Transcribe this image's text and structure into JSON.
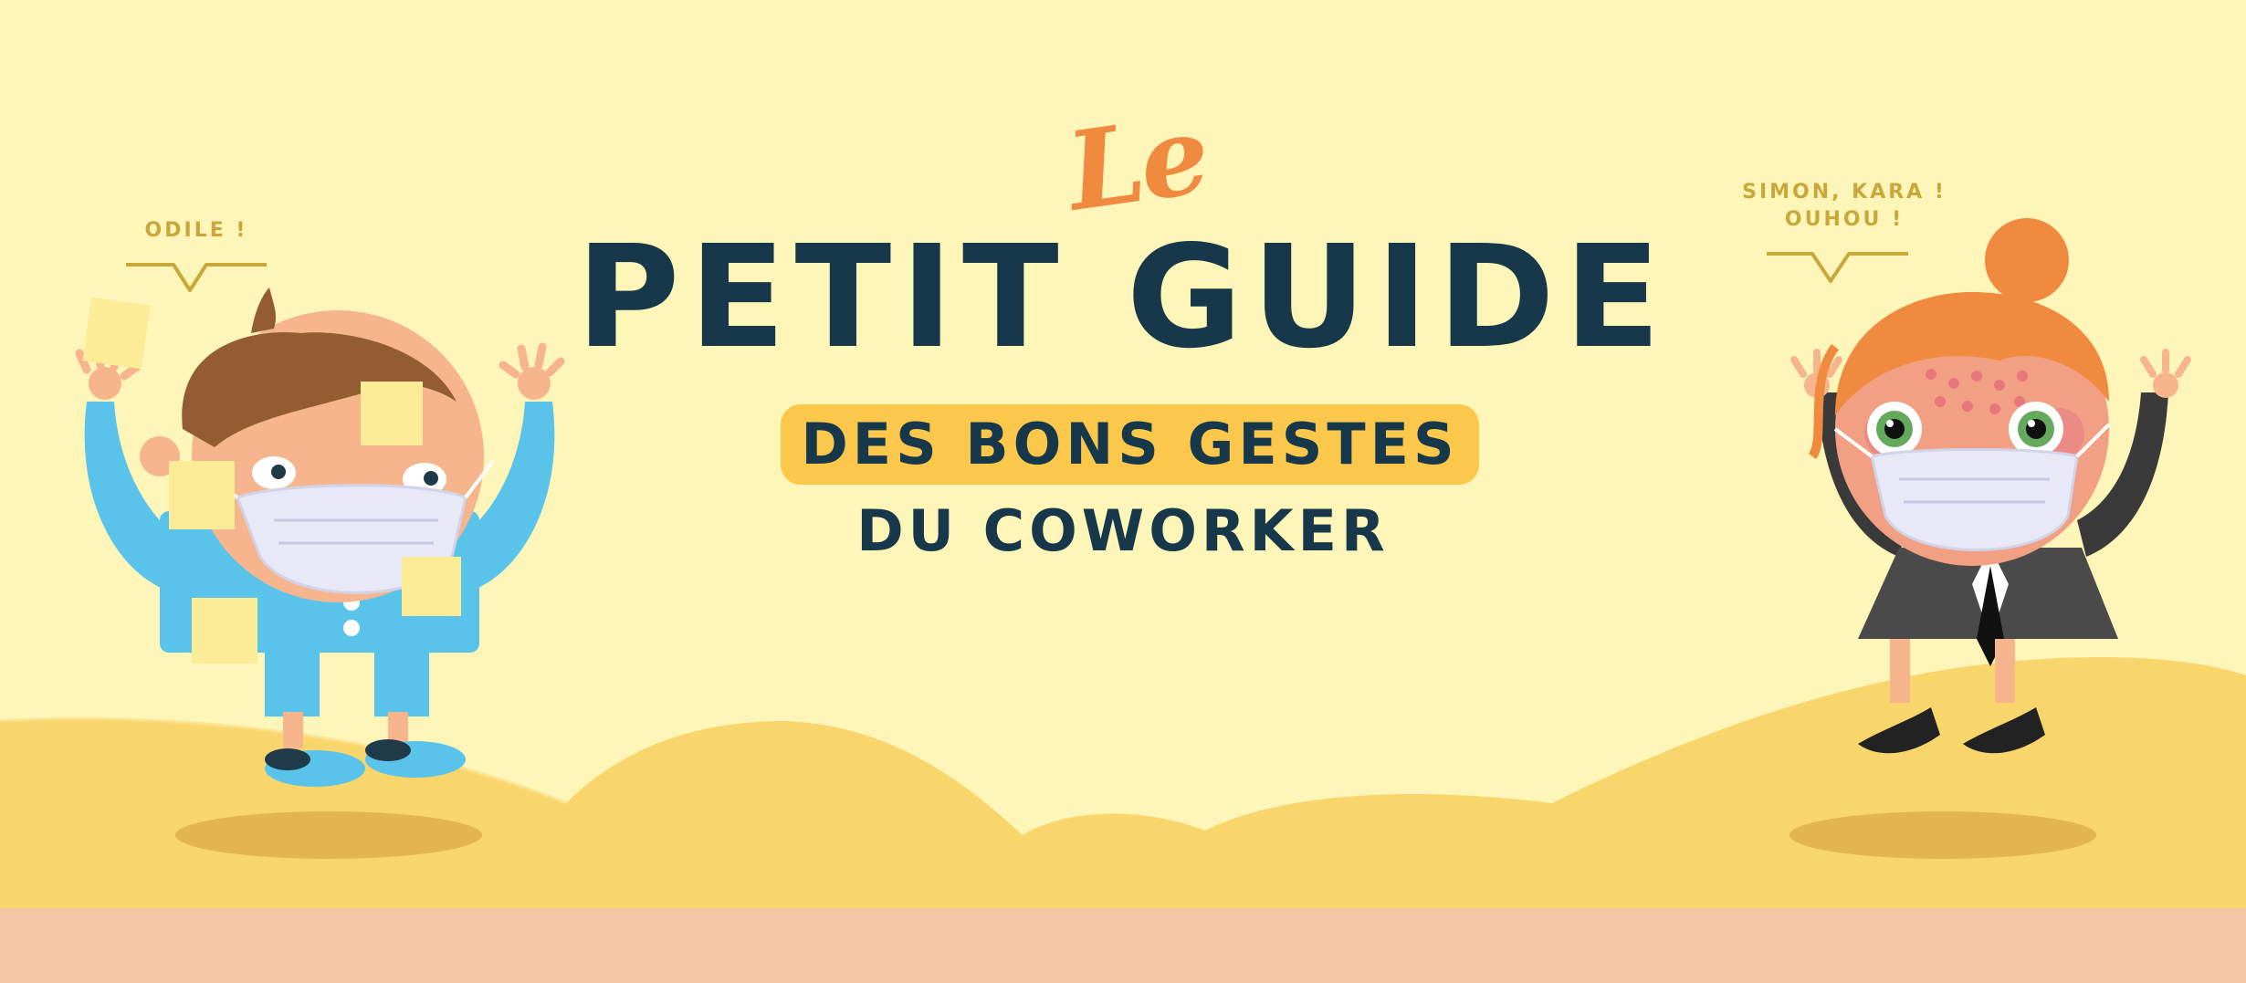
{
  "banner": {
    "le": "Le",
    "title": "PETIT GUIDE",
    "subtitle_line1": "DES BONS GESTES",
    "subtitle_line2": "DU COWORKER"
  },
  "speech": {
    "left": "ODILE !",
    "right_line1": "SIMON, KARA !",
    "right_line2": "OUHOU !"
  },
  "colors": {
    "background": "#fdf6b8",
    "hills": "#f9d66b",
    "title_navy": "#16384a",
    "accent_orange": "#ef8a3e",
    "pill_yellow": "#fbc84c",
    "bubble_gold": "#c9a83b",
    "bottom_band": "#f6c5a6"
  },
  "illustrations": {
    "left_character": "man-with-sticky-notes-and-mask",
    "right_character": "red-haired-woman-with-mask"
  }
}
